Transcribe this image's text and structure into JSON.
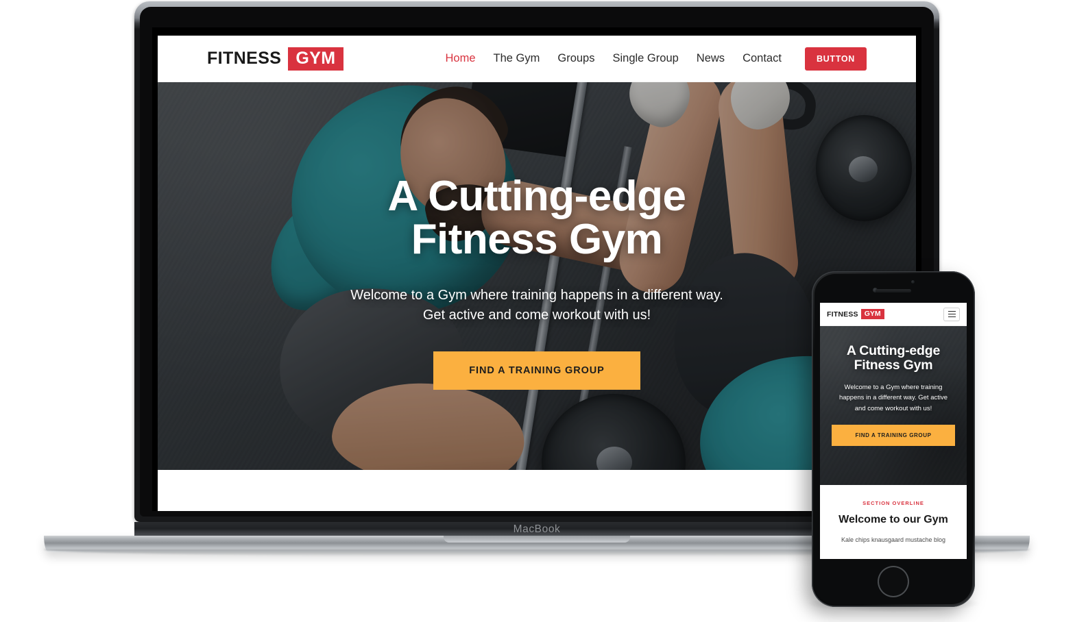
{
  "theme": {
    "brand_red": "#d9333f",
    "accent_yellow": "#fbb040",
    "text_dark": "#1a1a1a"
  },
  "devices": {
    "laptop_label": "MacBook"
  },
  "desktop": {
    "header": {
      "logo": {
        "word": "FITNESS",
        "badge": "GYM"
      },
      "nav": [
        {
          "label": "Home",
          "active": true
        },
        {
          "label": "The Gym",
          "active": false
        },
        {
          "label": "Groups",
          "active": false
        },
        {
          "label": "Single Group",
          "active": false
        },
        {
          "label": "News",
          "active": false
        },
        {
          "label": "Contact",
          "active": false
        }
      ],
      "cta_button": "BUTTON"
    },
    "hero": {
      "title_line1": "A Cutting-edge",
      "title_line2": "Fitness Gym",
      "subtitle": "Welcome to a Gym where training happens in a different way. Get active and come workout with us!",
      "cta": "FIND A TRAINING GROUP"
    }
  },
  "mobile": {
    "header": {
      "logo": {
        "word": "FITNESS",
        "badge": "GYM"
      },
      "menu_icon": "hamburger-icon"
    },
    "hero": {
      "title_line1": "A Cutting-edge",
      "title_line2": "Fitness Gym",
      "subtitle": "Welcome to a Gym where training happens in a different way. Get active and come workout with us!",
      "cta": "FIND A TRAINING GROUP"
    },
    "section": {
      "overline": "SECTION OVERLINE",
      "heading": "Welcome to our Gym",
      "body": "Kale chips knausgaard mustache blog"
    }
  }
}
